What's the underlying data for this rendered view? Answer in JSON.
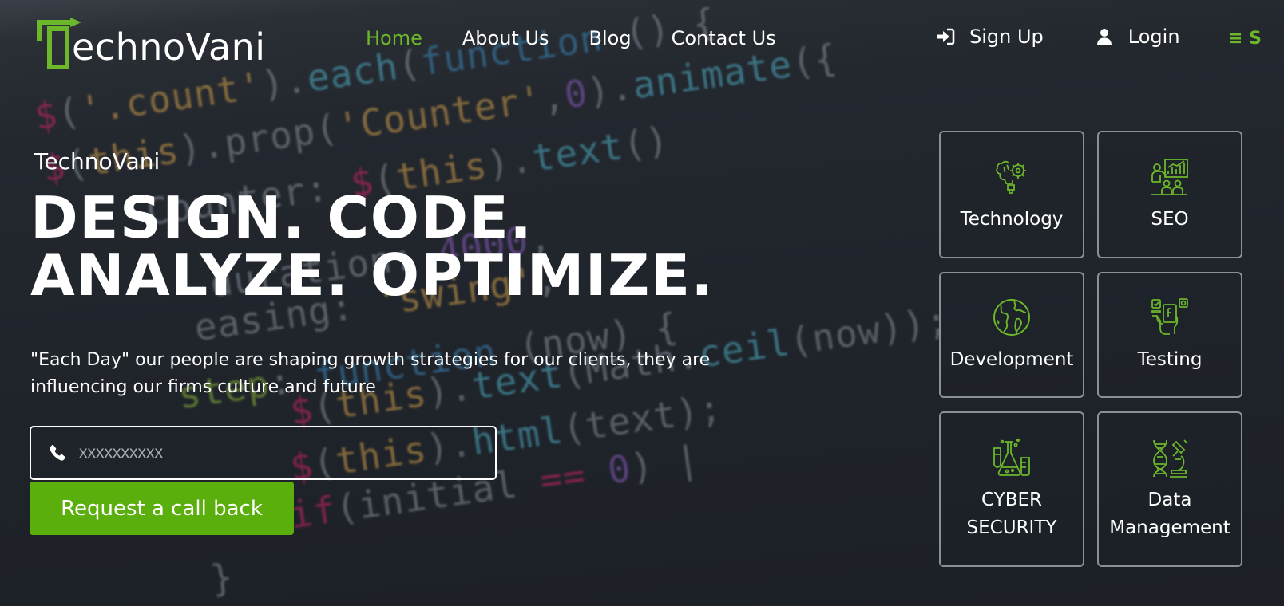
{
  "brand": {
    "logo_text": "echnoVani",
    "accent_color": "#6cb72a"
  },
  "nav": {
    "items": [
      {
        "label": "Home"
      },
      {
        "label": "About Us"
      },
      {
        "label": "Blog"
      },
      {
        "label": "Contact Us"
      }
    ],
    "active_index": 0
  },
  "auth": {
    "signup_label": "Sign Up",
    "signup_icon": "sign-in-icon",
    "login_label": "Login",
    "login_icon": "user-icon"
  },
  "menu_toggle": {
    "label": "≡ S",
    "icon": "hamburger-icon"
  },
  "hero": {
    "kicker": "TechnoVani",
    "title_line1": "DESIGN. CODE.",
    "title_line2": "ANALYZE. OPTIMIZE.",
    "description": "\"Each Day\" our people are shaping growth strategies for our clients, they are influencing our firms culture and future"
  },
  "phone_form": {
    "icon": "phone-icon",
    "placeholder": "xxxxxxxxxx",
    "value": "",
    "submit_label": "Request a call back"
  },
  "services": [
    {
      "label": "Technology",
      "icon": "brain-gear-icon"
    },
    {
      "label": "SEO",
      "icon": "presentation-chart-icon"
    },
    {
      "label": "Development",
      "icon": "globe-icon"
    },
    {
      "label": "Testing",
      "icon": "hand-social-icon"
    },
    {
      "label": "CYBER SECURITY",
      "icon": "lab-flask-icon"
    },
    {
      "label": "Data Management",
      "icon": "dna-microscope-icon"
    }
  ],
  "colors": {
    "background": "#22262d",
    "cta": "#5aaf0c",
    "tile_border": "#8b8f98"
  }
}
